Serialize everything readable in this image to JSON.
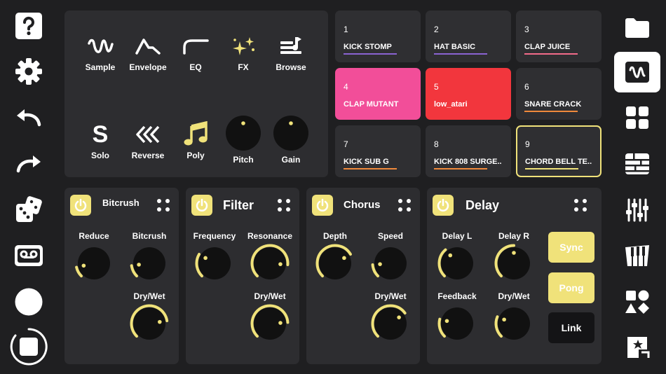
{
  "colors": {
    "background": "#1f1f21",
    "panel": "#2d2d30",
    "accent_yellow": "#f0e27a",
    "pad_pink": "#f24e99",
    "pad_red": "#f2363d"
  },
  "left_sidebar": {
    "items": [
      {
        "name": "help-icon"
      },
      {
        "name": "settings-gear-icon"
      },
      {
        "name": "undo-icon"
      },
      {
        "name": "redo-icon"
      },
      {
        "name": "dice-random-icon"
      },
      {
        "name": "tape-recorder-icon"
      },
      {
        "name": "record-circle-icon"
      },
      {
        "name": "stop-square-icon"
      }
    ]
  },
  "right_sidebar": {
    "items": [
      {
        "name": "folder-icon"
      },
      {
        "name": "waveform-icon",
        "active": true
      },
      {
        "name": "pad-grid-icon"
      },
      {
        "name": "sequencer-icon"
      },
      {
        "name": "mixer-sliders-icon"
      },
      {
        "name": "keyboard-icon"
      },
      {
        "name": "shapes-icon"
      },
      {
        "name": "export-star-icon"
      }
    ]
  },
  "tools": {
    "sample": "Sample",
    "envelope": "Envelope",
    "eq": "EQ",
    "fx": "FX",
    "browse": "Browse",
    "solo": "Solo",
    "solo_glyph": "S",
    "reverse": "Reverse",
    "poly": "Poly",
    "pitch": "Pitch",
    "gain": "Gain"
  },
  "pads": [
    {
      "num": "1",
      "name": "KICK STOMP",
      "line": "#8a63d2",
      "bg": "#2f2f32"
    },
    {
      "num": "2",
      "name": "HAT BASIC",
      "line": "#8a63d2",
      "bg": "#2f2f32"
    },
    {
      "num": "3",
      "name": "CLAP JUICE",
      "line": "#f26b8a",
      "bg": "#2f2f32"
    },
    {
      "num": "4",
      "name": "CLAP MUTANT",
      "line": "",
      "bg": "#f24e99"
    },
    {
      "num": "5",
      "name": "low_atari",
      "line": "",
      "bg": "#f2363d"
    },
    {
      "num": "6",
      "name": "SNARE CRACK",
      "line": "#f08a3c",
      "bg": "#2f2f32"
    },
    {
      "num": "7",
      "name": "KICK SUB G",
      "line": "#f08a3c",
      "bg": "#2f2f32"
    },
    {
      "num": "8",
      "name": "KICK 808 SURGE..",
      "line": "#f08a3c",
      "bg": "#2f2f32"
    },
    {
      "num": "9",
      "name": "CHORD BELL TE..",
      "line": "#f0e27a",
      "bg": "#2f2f32",
      "selected": true
    }
  ],
  "fx_units": {
    "bitcrush": {
      "title": "Bitcrush",
      "reduce": "Reduce",
      "bitcrush": "Bitcrush",
      "drywet": "Dry/Wet",
      "values": {
        "reduce": 0.12,
        "bitcrush": 0.14,
        "drywet": 0.8
      }
    },
    "filter": {
      "title": "Filter",
      "frequency": "Frequency",
      "resonance": "Resonance",
      "drywet": "Dry/Wet",
      "values": {
        "frequency": 0.28,
        "resonance": 0.85,
        "drywet": 0.82
      }
    },
    "chorus": {
      "title": "Chorus",
      "depth": "Depth",
      "speed": "Speed",
      "drywet": "Dry/Wet",
      "values": {
        "depth": 0.72,
        "speed": 0.15,
        "drywet": 0.7
      }
    },
    "delay": {
      "title": "Delay",
      "delay_l": "Delay L",
      "delay_r": "Delay R",
      "feedback": "Feedback",
      "drywet": "Dry/Wet",
      "values": {
        "delay_l": 0.35,
        "delay_r": 0.5,
        "feedback": 0.22,
        "drywet": 0.25
      },
      "sync": "Sync",
      "pong": "Pong",
      "link": "Link"
    }
  }
}
